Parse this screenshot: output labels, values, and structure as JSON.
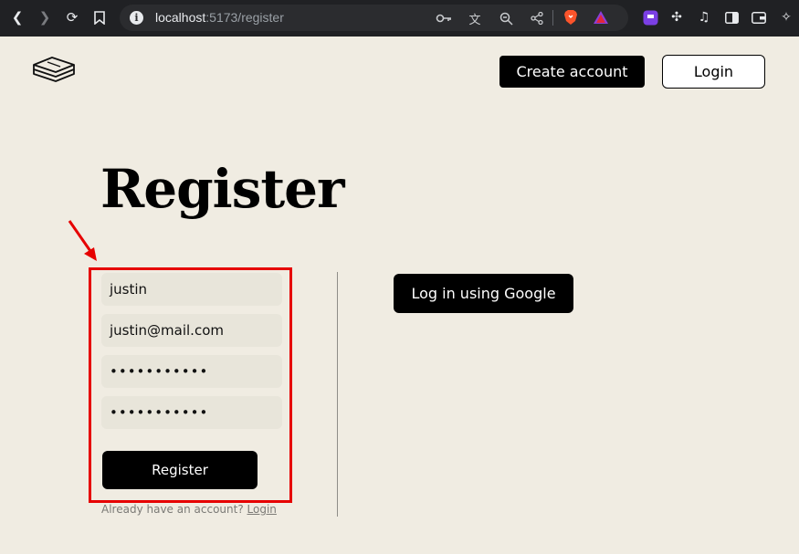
{
  "browser": {
    "url_host": "localhost",
    "url_rest": ":5173/register"
  },
  "header": {
    "logo_icon": "stacked-books-icon",
    "create_account_label": "Create account",
    "login_label": "Login"
  },
  "main": {
    "title": "Register",
    "form": {
      "username_value": "justin",
      "email_value": "justin@mail.com",
      "password_value": "•••••••••••",
      "confirm_password_value": "•••••••••••",
      "submit_label": "Register"
    },
    "already_text": "Already have an account?",
    "already_link": "Login",
    "google_label": "Log in using Google"
  },
  "annotation": {
    "highlight_color": "#e60000"
  }
}
